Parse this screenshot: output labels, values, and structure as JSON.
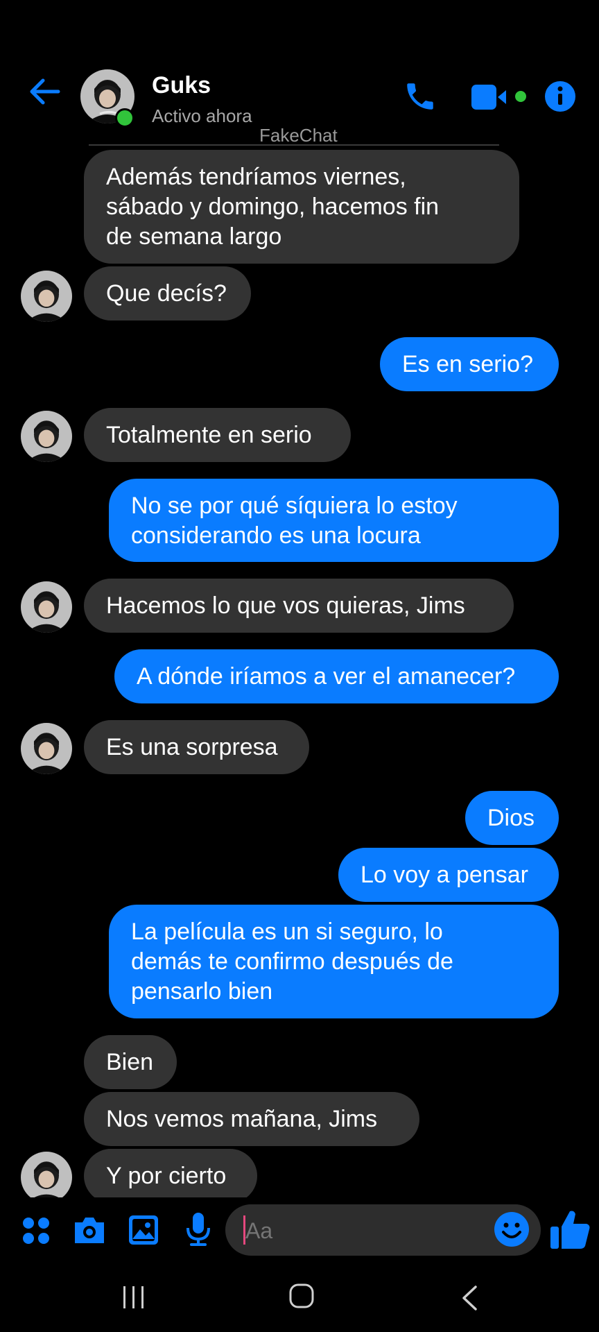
{
  "header": {
    "contact_name": "Guks",
    "status": "Activo ahora",
    "watermark": "FakeChat"
  },
  "colors": {
    "accent": "#0a7cff",
    "incoming_bubble": "#333333",
    "online": "#31c43b",
    "background": "#000000"
  },
  "messages": [
    {
      "from": "them",
      "text": "Además tendríamos viernes,\nsábado y domingo, hacemos fin\nde semana largo"
    },
    {
      "from": "them",
      "text": "Que decís?"
    },
    {
      "from": "me",
      "text": "Es en serio?"
    },
    {
      "from": "them",
      "text": "Totalmente en serio"
    },
    {
      "from": "me",
      "text": "No se por qué síquiera lo estoy\nconsiderando es una locura"
    },
    {
      "from": "them",
      "text": "Hacemos lo que vos quieras, Jims"
    },
    {
      "from": "me",
      "text": "A dónde iríamos a ver el amanecer?"
    },
    {
      "from": "them",
      "text": "Es una sorpresa"
    },
    {
      "from": "me",
      "text": "Dios"
    },
    {
      "from": "me",
      "text": "Lo voy a pensar"
    },
    {
      "from": "me",
      "text": "La película es un si seguro, lo\ndemás te confirmo después de\npensarlo bien"
    },
    {
      "from": "them",
      "text": "Bien"
    },
    {
      "from": "them",
      "text": "Nos vemos mañana, Jims"
    },
    {
      "from": "them",
      "text": "Y por cierto"
    }
  ],
  "composer": {
    "placeholder": "Aa",
    "icons": [
      "apps-icon",
      "camera-icon",
      "gallery-icon",
      "microphone-icon",
      "emoji-icon",
      "like-icon"
    ]
  },
  "nav": {
    "icons": [
      "recent-apps-icon",
      "home-icon",
      "back-icon"
    ]
  }
}
